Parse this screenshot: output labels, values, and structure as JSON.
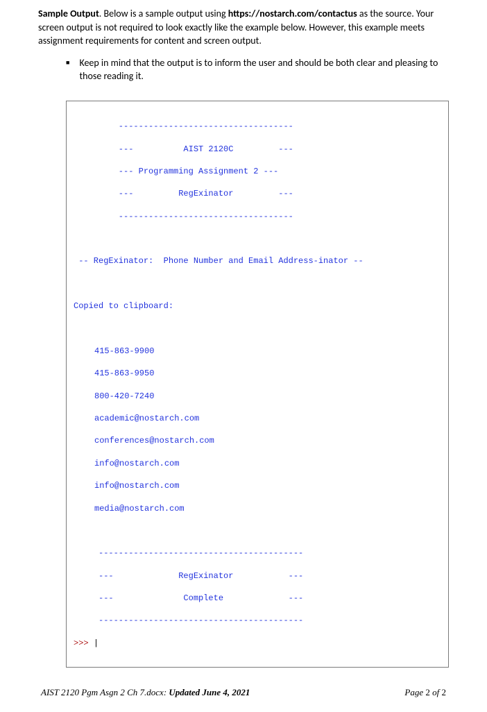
{
  "p1": {
    "lead": "Sample Output",
    "t1": ". Below is a sample output using ",
    "url": "https://nostarch.com/contactus",
    "t2": " as the source. Your screen output is not required to look exactly like the example below. However, this example meets assignment requirements for content and screen output."
  },
  "bullet": {
    "mark": "■",
    "text": "Keep in mind that the output is to inform the user and should be both clear and pleasing to those reading it."
  },
  "output": {
    "hr1": "         -----------------------------------",
    "l1": "         ---          AIST 2120C         ---",
    "l2": "         --- Programming Assignment 2 ---",
    "l3": "         ---         RegExinator         ---",
    "hr2": "         -----------------------------------",
    "blank": " ",
    "sub": " -- RegExinator:  Phone Number and Email Address-inator --",
    "copied": "Copied to clipboard:",
    "r1": "415-863-9900",
    "r2": "415-863-9950",
    "r3": "800-420-7240",
    "r4": "academic@nostarch.com",
    "r5": "conferences@nostarch.com",
    "r6": "info@nostarch.com",
    "r7": "info@nostarch.com",
    "r8": "media@nostarch.com",
    "fhr1": "     -----------------------------------------",
    "f1": "     ---             RegExinator           ---",
    "f2": "     ---              Complete             ---",
    "fhr2": "     -----------------------------------------",
    "prompt": ">>> ",
    "cursor": "|"
  },
  "footer": {
    "left_i": "AIST 2120 Pgm Asgn 2 Ch 7.docx:",
    "left_bi": " Updated June 4, 2021",
    "right_i1": "Page ",
    "right_n1": "2",
    "right_i2": " of ",
    "right_n2": "2"
  }
}
